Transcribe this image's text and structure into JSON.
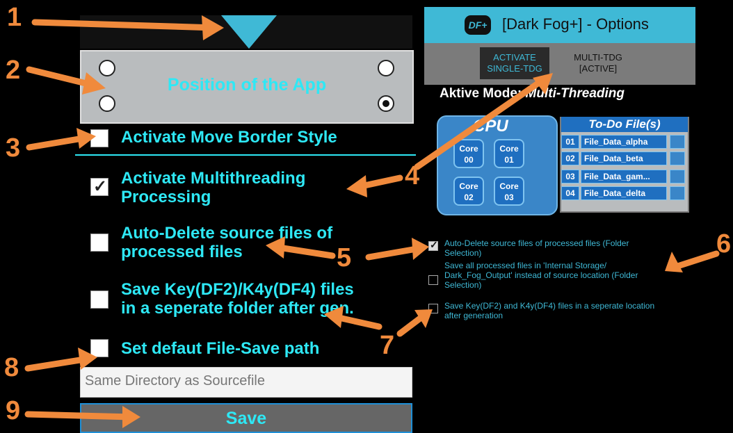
{
  "annotations": [
    "1",
    "2",
    "3",
    "4",
    "5",
    "6",
    "7",
    "8",
    "9"
  ],
  "left": {
    "position_label": "Position of the App",
    "radios": [
      false,
      false,
      false,
      true
    ],
    "options": [
      {
        "label_lines": [
          "Activate Move Border Style"
        ],
        "checked": false
      },
      {
        "label_lines": [
          "Activate Multithreading",
          "Processing"
        ],
        "checked": true
      },
      {
        "label_lines": [
          "Auto-Delete source files of",
          "processed files"
        ],
        "checked": false
      },
      {
        "label_lines": [
          "Save Key(DF2)/K4y(DF4) files",
          "in a seperate folder after gen."
        ],
        "checked": false
      },
      {
        "label_lines": [
          "Set defaut File-Save path"
        ],
        "checked": false
      }
    ],
    "path_placeholder": "Same Directory as Sourcefile",
    "save_label": "Save"
  },
  "right": {
    "logo_text": "DF+",
    "title": "[Dark Fog+] - Options",
    "mode_single_lines": [
      "ACTIVATE",
      "SINGLE-TDG"
    ],
    "mode_multi_lines": [
      "MULTI-TDG",
      "[ACTIVE]"
    ],
    "aktive_prefix": "Aktive Mode:",
    "aktive_mode": "Multi-Threading",
    "cpu_label": "CPU",
    "cores": [
      {
        "line1": "Core",
        "line2": "00"
      },
      {
        "line1": "Core",
        "line2": "01"
      },
      {
        "line1": "Core",
        "line2": "02"
      },
      {
        "line1": "Core",
        "line2": "03"
      }
    ],
    "todo_title": "To-Do File(s)",
    "todo_rows": [
      {
        "num": "01",
        "name": "File_Data_alpha"
      },
      {
        "num": "02",
        "name": "File_Data_beta"
      },
      {
        "num": "03",
        "name": "File_Data_gam..."
      },
      {
        "num": "04",
        "name": "File_Data_delta"
      }
    ],
    "options": [
      {
        "lines": [
          "Auto-Delete source files of processed files (Folder",
          "Selection)"
        ],
        "checked": true
      },
      {
        "lines": [
          "Save all processed files in 'Internal Storage/",
          "Dark_Fog_Output' instead of source location (Folder",
          "Selection)"
        ],
        "checked": false
      },
      {
        "lines": [
          "Save Key(DF2) and K4y(DF4) files in a seperate location",
          "after generation"
        ],
        "checked": false
      }
    ]
  },
  "colors": {
    "accent": "#2ee8f5",
    "annotation": "#f08a3c",
    "app_bar": "#3fb9d6"
  }
}
